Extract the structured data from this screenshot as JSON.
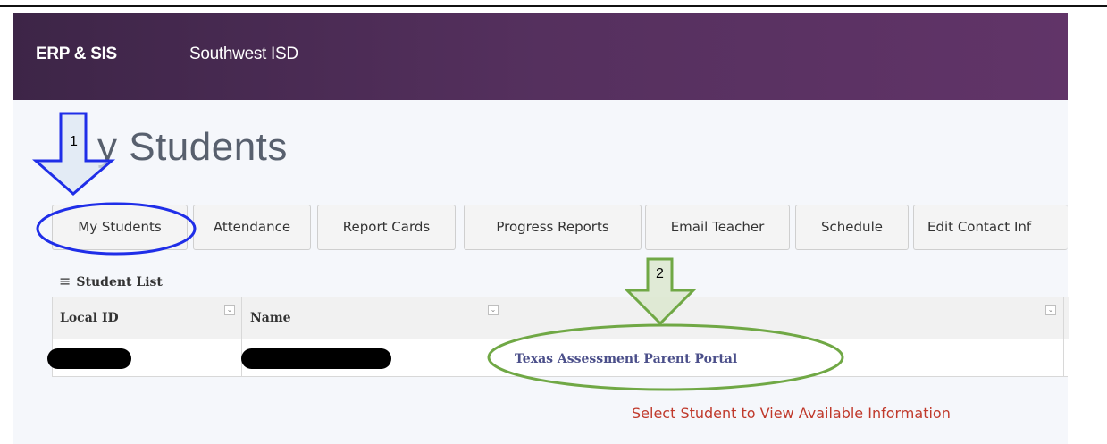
{
  "header": {
    "brand": "ERP & SIS",
    "district": "Southwest ISD"
  },
  "page": {
    "title": "My Students",
    "title_visible": "y Students"
  },
  "tabs": [
    {
      "label": "My Students"
    },
    {
      "label": "Attendance"
    },
    {
      "label": "Report Cards"
    },
    {
      "label": "Progress Reports"
    },
    {
      "label": "Email Teacher"
    },
    {
      "label": "Schedule"
    },
    {
      "label": "Edit Contact Inf"
    }
  ],
  "student_list": {
    "title": "Student List",
    "columns": [
      "Local ID",
      "Name",
      ""
    ],
    "rows": [
      {
        "local_id": "[redacted]",
        "name": "[redacted]",
        "link": "Texas Assessment Parent Portal"
      }
    ]
  },
  "message": "Select Student to View Available Information",
  "annotations": {
    "step1": "1",
    "step2": "2"
  },
  "colors": {
    "header_start": "#3d2547",
    "header_end": "#613468",
    "link": "#4b4f8a",
    "message": "#c0392b",
    "annotation_blue": "#1f2ee8",
    "annotation_green": "#70a845"
  }
}
